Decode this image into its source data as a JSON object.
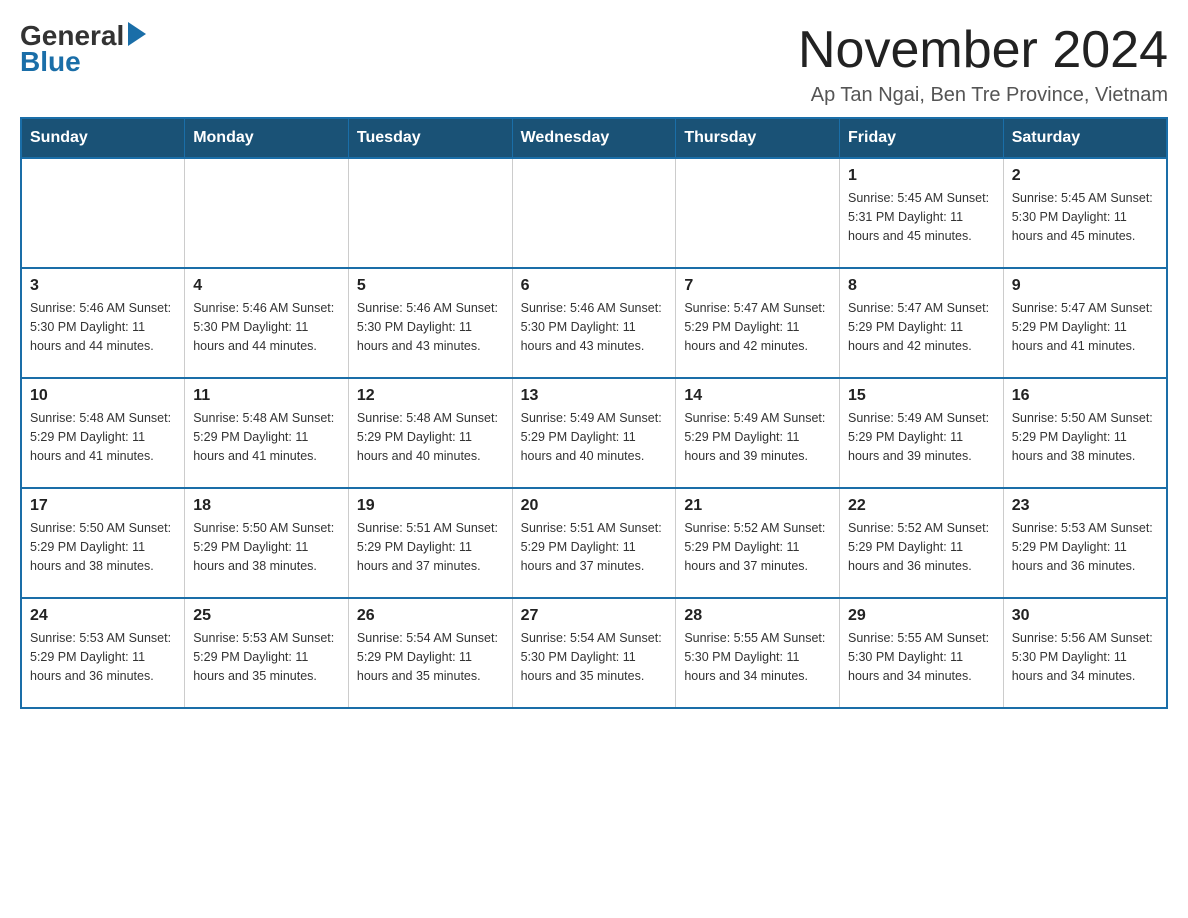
{
  "logo": {
    "general": "General",
    "blue": "Blue"
  },
  "title": "November 2024",
  "subtitle": "Ap Tan Ngai, Ben Tre Province, Vietnam",
  "days_of_week": [
    "Sunday",
    "Monday",
    "Tuesday",
    "Wednesday",
    "Thursday",
    "Friday",
    "Saturday"
  ],
  "weeks": [
    [
      {
        "day": "",
        "info": ""
      },
      {
        "day": "",
        "info": ""
      },
      {
        "day": "",
        "info": ""
      },
      {
        "day": "",
        "info": ""
      },
      {
        "day": "",
        "info": ""
      },
      {
        "day": "1",
        "info": "Sunrise: 5:45 AM\nSunset: 5:31 PM\nDaylight: 11 hours and 45 minutes."
      },
      {
        "day": "2",
        "info": "Sunrise: 5:45 AM\nSunset: 5:30 PM\nDaylight: 11 hours and 45 minutes."
      }
    ],
    [
      {
        "day": "3",
        "info": "Sunrise: 5:46 AM\nSunset: 5:30 PM\nDaylight: 11 hours and 44 minutes."
      },
      {
        "day": "4",
        "info": "Sunrise: 5:46 AM\nSunset: 5:30 PM\nDaylight: 11 hours and 44 minutes."
      },
      {
        "day": "5",
        "info": "Sunrise: 5:46 AM\nSunset: 5:30 PM\nDaylight: 11 hours and 43 minutes."
      },
      {
        "day": "6",
        "info": "Sunrise: 5:46 AM\nSunset: 5:30 PM\nDaylight: 11 hours and 43 minutes."
      },
      {
        "day": "7",
        "info": "Sunrise: 5:47 AM\nSunset: 5:29 PM\nDaylight: 11 hours and 42 minutes."
      },
      {
        "day": "8",
        "info": "Sunrise: 5:47 AM\nSunset: 5:29 PM\nDaylight: 11 hours and 42 minutes."
      },
      {
        "day": "9",
        "info": "Sunrise: 5:47 AM\nSunset: 5:29 PM\nDaylight: 11 hours and 41 minutes."
      }
    ],
    [
      {
        "day": "10",
        "info": "Sunrise: 5:48 AM\nSunset: 5:29 PM\nDaylight: 11 hours and 41 minutes."
      },
      {
        "day": "11",
        "info": "Sunrise: 5:48 AM\nSunset: 5:29 PM\nDaylight: 11 hours and 41 minutes."
      },
      {
        "day": "12",
        "info": "Sunrise: 5:48 AM\nSunset: 5:29 PM\nDaylight: 11 hours and 40 minutes."
      },
      {
        "day": "13",
        "info": "Sunrise: 5:49 AM\nSunset: 5:29 PM\nDaylight: 11 hours and 40 minutes."
      },
      {
        "day": "14",
        "info": "Sunrise: 5:49 AM\nSunset: 5:29 PM\nDaylight: 11 hours and 39 minutes."
      },
      {
        "day": "15",
        "info": "Sunrise: 5:49 AM\nSunset: 5:29 PM\nDaylight: 11 hours and 39 minutes."
      },
      {
        "day": "16",
        "info": "Sunrise: 5:50 AM\nSunset: 5:29 PM\nDaylight: 11 hours and 38 minutes."
      }
    ],
    [
      {
        "day": "17",
        "info": "Sunrise: 5:50 AM\nSunset: 5:29 PM\nDaylight: 11 hours and 38 minutes."
      },
      {
        "day": "18",
        "info": "Sunrise: 5:50 AM\nSunset: 5:29 PM\nDaylight: 11 hours and 38 minutes."
      },
      {
        "day": "19",
        "info": "Sunrise: 5:51 AM\nSunset: 5:29 PM\nDaylight: 11 hours and 37 minutes."
      },
      {
        "day": "20",
        "info": "Sunrise: 5:51 AM\nSunset: 5:29 PM\nDaylight: 11 hours and 37 minutes."
      },
      {
        "day": "21",
        "info": "Sunrise: 5:52 AM\nSunset: 5:29 PM\nDaylight: 11 hours and 37 minutes."
      },
      {
        "day": "22",
        "info": "Sunrise: 5:52 AM\nSunset: 5:29 PM\nDaylight: 11 hours and 36 minutes."
      },
      {
        "day": "23",
        "info": "Sunrise: 5:53 AM\nSunset: 5:29 PM\nDaylight: 11 hours and 36 minutes."
      }
    ],
    [
      {
        "day": "24",
        "info": "Sunrise: 5:53 AM\nSunset: 5:29 PM\nDaylight: 11 hours and 36 minutes."
      },
      {
        "day": "25",
        "info": "Sunrise: 5:53 AM\nSunset: 5:29 PM\nDaylight: 11 hours and 35 minutes."
      },
      {
        "day": "26",
        "info": "Sunrise: 5:54 AM\nSunset: 5:29 PM\nDaylight: 11 hours and 35 minutes."
      },
      {
        "day": "27",
        "info": "Sunrise: 5:54 AM\nSunset: 5:30 PM\nDaylight: 11 hours and 35 minutes."
      },
      {
        "day": "28",
        "info": "Sunrise: 5:55 AM\nSunset: 5:30 PM\nDaylight: 11 hours and 34 minutes."
      },
      {
        "day": "29",
        "info": "Sunrise: 5:55 AM\nSunset: 5:30 PM\nDaylight: 11 hours and 34 minutes."
      },
      {
        "day": "30",
        "info": "Sunrise: 5:56 AM\nSunset: 5:30 PM\nDaylight: 11 hours and 34 minutes."
      }
    ]
  ]
}
